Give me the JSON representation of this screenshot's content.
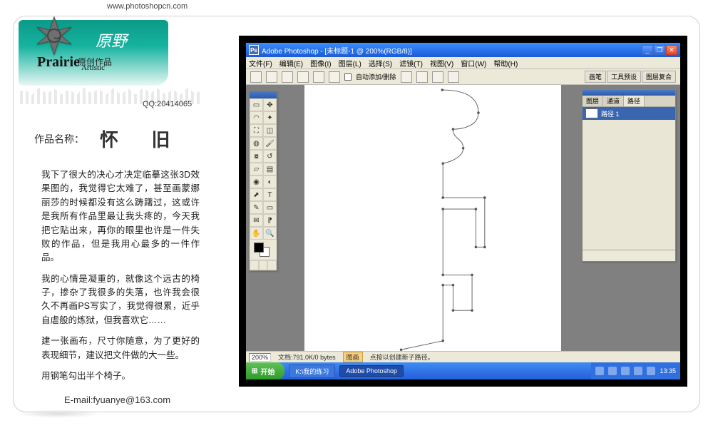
{
  "site_url": "www.photoshopcn.com",
  "brand": {
    "english": "Prairie",
    "english_sub": "Artistic",
    "chinese_script": "原野",
    "chinese_label": "原创作品"
  },
  "qq": "QQ:20414065",
  "title_label": "作品名称：",
  "artwork_name": "怀 旧",
  "description": {
    "p1": "我下了很大的决心才决定临摹这张3D效果图的，我觉得它太难了，甚至画蒙娜丽莎的时候都没有这么踌躇过，这或许是我所有作品里最让我头疼的，今天我把它贴出来，再你的眼里也许是一件失败的作品，但是我用心最多的一件作品。",
    "p2": "我的心情是凝重的，就像这个远古的椅子，掺杂了我很多的失落，也许我会很久不再画PS写实了，我觉得很累，近乎自虐般的炼狱，但我喜欢它……",
    "p3": "建一张画布，尺寸你随意，为了更好的表现细节，建议把文件做的大一些。",
    "p4": "用钢笔勾出半个椅子。"
  },
  "email": "E-mail:fyuanye@163.com",
  "photoshop": {
    "titlebar": "Adobe Photoshop - [未标题-1 @ 200%(RGB/8)]",
    "menu": [
      "文件(F)",
      "编辑(E)",
      "图像(I)",
      "图层(L)",
      "选择(S)",
      "滤镜(T)",
      "视图(V)",
      "窗口(W)",
      "帮助(H)"
    ],
    "opt_auto": "自动添加/删除",
    "opt_tabs": [
      "画笔",
      "工具预设",
      "图层复合"
    ],
    "paths_panel": {
      "tabs": [
        "图层",
        "通道",
        "路径"
      ],
      "item": "路径 1"
    },
    "status": {
      "zoom": "200%",
      "doc": "文档:791.0K/0 bytes",
      "tip_icon": "图画",
      "tip": "点按以创建新子路径。"
    }
  },
  "taskbar": {
    "start": "开始",
    "tasks": [
      "K:\\我的练习",
      "Adobe Photoshop"
    ],
    "time": "13:35"
  }
}
